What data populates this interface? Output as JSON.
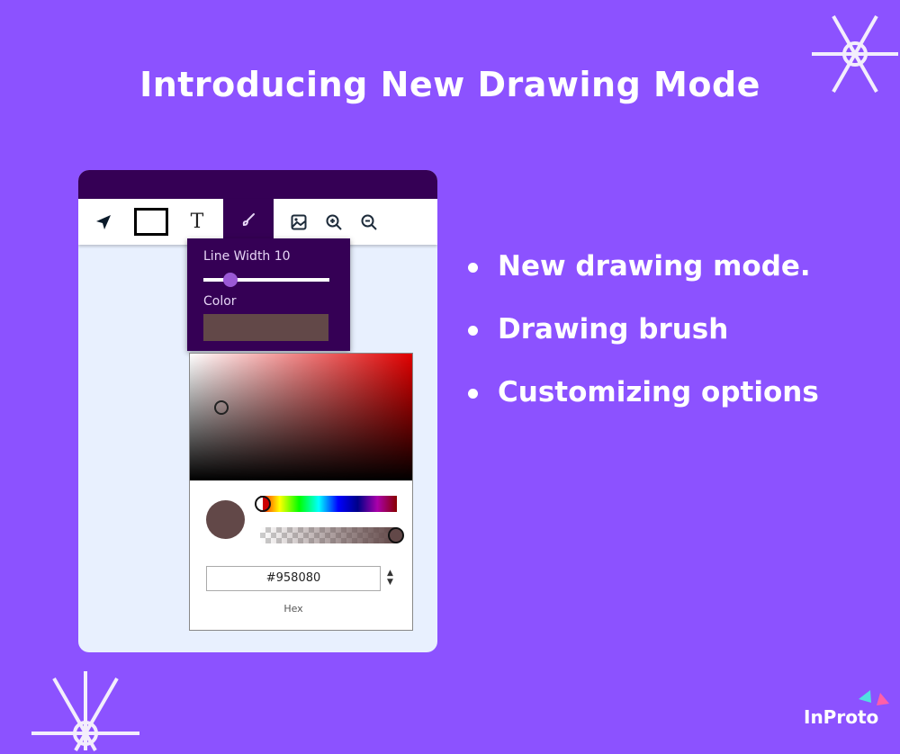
{
  "title": "Introducing New Drawing Mode",
  "toolbar": {
    "tools": [
      {
        "name": "select",
        "icon": "navigation-arrow-icon"
      },
      {
        "name": "rectangle",
        "icon": "rectangle-icon"
      },
      {
        "name": "text",
        "icon": "text-icon",
        "glyph": "T"
      },
      {
        "name": "brush",
        "icon": "brush-icon",
        "active": true
      },
      {
        "name": "image",
        "icon": "image-icon"
      },
      {
        "name": "zoom-in",
        "icon": "zoom-in-icon"
      },
      {
        "name": "zoom-out",
        "icon": "zoom-out-icon"
      }
    ]
  },
  "brush_popover": {
    "line_width_label": "Line Width 10",
    "line_width": 10,
    "color_label": "Color",
    "color": "#624848"
  },
  "color_picker": {
    "hex_value": "#958080",
    "format_label": "Hex",
    "hue": 0,
    "alpha": 1
  },
  "features": [
    "New drawing mode.",
    "Drawing brush",
    "Customizing options"
  ],
  "brand": {
    "logo_text": "InProto",
    "colors": {
      "background": "#8c52ff",
      "dark": "#350055",
      "canvas": "#e8f0fe"
    }
  }
}
